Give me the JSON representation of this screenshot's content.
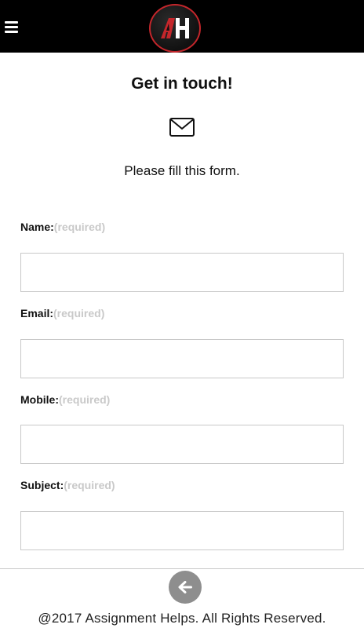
{
  "header": {
    "menu_icon": "hamburger-menu-icon",
    "logo_text": "AH"
  },
  "page": {
    "title": "Get in touch!",
    "mail_icon": "envelope-icon",
    "subtitle": "Please fill this form."
  },
  "form": {
    "fields": [
      {
        "label": "Name:",
        "hint": "(required)",
        "value": "",
        "placeholder": ""
      },
      {
        "label": "Email:",
        "hint": "(required)",
        "value": "",
        "placeholder": ""
      },
      {
        "label": "Mobile:",
        "hint": "(required)",
        "value": "",
        "placeholder": ""
      },
      {
        "label": "Subject:",
        "hint": "(required)",
        "value": "",
        "placeholder": ""
      }
    ]
  },
  "footer": {
    "back_icon": "arrow-left-icon",
    "copyright": "@2017 Assignment Helps. All Rights Reserved."
  },
  "colors": {
    "header_bg": "#000000",
    "logo_accent": "#c4262b",
    "hint": "#c9c9c9",
    "back_button": "#8e8e8e"
  }
}
